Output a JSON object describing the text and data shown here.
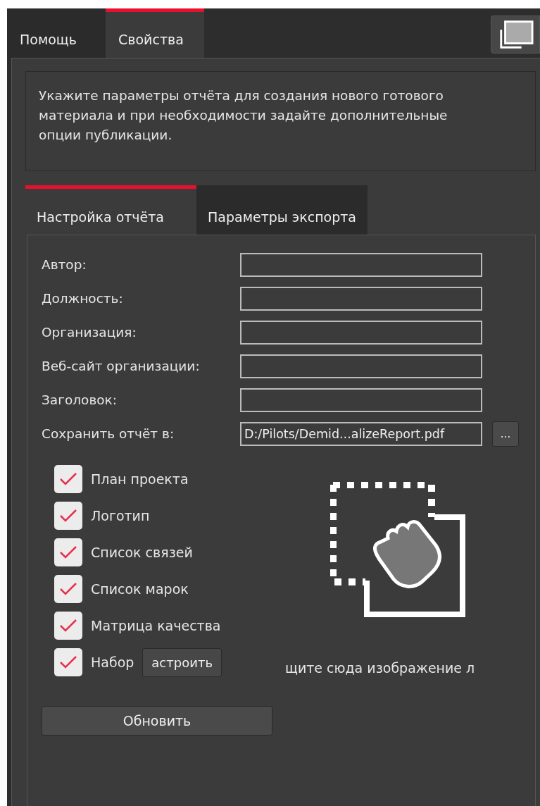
{
  "tabs": [
    {
      "label": "Помощь",
      "selected": false
    },
    {
      "label": "Свойства",
      "selected": true
    }
  ],
  "description": "Укажите параметры отчёта для создания нового готового материала и при необходимости задайте дополнительные опции публикации.",
  "subtabs": [
    {
      "label": "Настройка отчёта",
      "selected": true
    },
    {
      "label": "Параметры экспорта",
      "selected": false
    }
  ],
  "fields": [
    {
      "label": "Автор:"
    },
    {
      "label": "Должность:"
    },
    {
      "label": "Организация:"
    },
    {
      "label": "Веб-сайт организации:"
    },
    {
      "label": "Заголовок:"
    },
    {
      "label": "Сохранить отчёт в:",
      "value": "D:/Pilots/Demid...alizeReport.pdf",
      "browse": "..."
    }
  ],
  "options": [
    {
      "label": "План проекта",
      "checked": true
    },
    {
      "label": "Логотип",
      "checked": true
    },
    {
      "label": "Список связей",
      "checked": true
    },
    {
      "label": "Список марок",
      "checked": true
    },
    {
      "label": "Матрица качества",
      "checked": true
    },
    {
      "label": "Набор",
      "checked": true,
      "button": "астроить"
    }
  ],
  "drop_hint": "щите сюда изображение л",
  "update_button": "Обновить"
}
